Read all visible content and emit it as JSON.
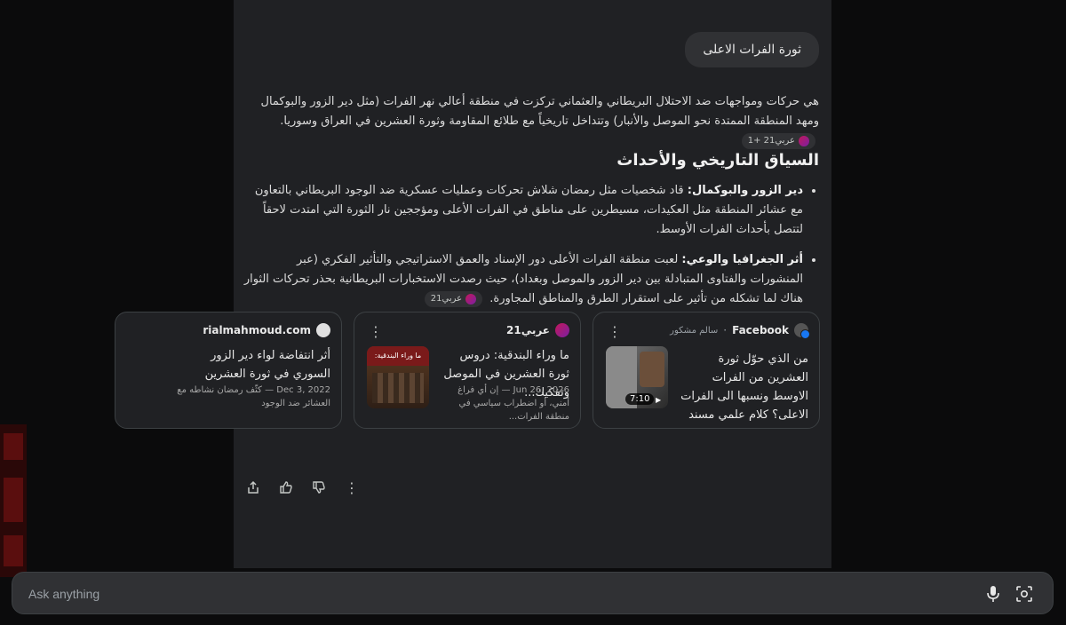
{
  "query": "ثورة الفرات الاعلى",
  "intro": {
    "text": "هي حركات ومواجهات ضد الاحتلال البريطاني والعثماني تركزت في منطقة أعالي نهر الفرات (مثل دير الزور والبوكمال ومهد المنطقة الممتدة نحو الموصل والأنبار) وتتداخل تاريخياً مع طلائع المقاومة وثورة العشرين في العراق وسوريا.",
    "citation": "عربي21 +1"
  },
  "section": {
    "heading": "السياق التاريخي والأحداث",
    "bullets": [
      {
        "bold": "دير الزور والبوكمال:",
        "text": " قاد شخصيات مثل رمضان شلاش تحركات وعمليات عسكرية ضد الوجود البريطاني بالتعاون مع عشائر المنطقة مثل العكيدات، مسيطرين على مناطق في الفرات الأعلى ومؤججين نار الثورة التي امتدت لاحقاً لتتصل بأحداث الفرات الأوسط.",
        "citation": ""
      },
      {
        "bold": "أثر الجغرافيا والوعي:",
        "text": " لعبت منطقة الفرات الأعلى دور الإسناد والعمق الاستراتيجي والتأثير الفكري (عبر المنشورات والفتاوى المتبادلة بين دير الزور والموصل وبغداد)، حيث رصدت الاستخبارات البريطانية بحذر تحركات الثوار هناك لما تشكله من تأثير على استقرار الطرق والمناطق المجاورة.",
        "citation": "عربي21"
      }
    ]
  },
  "cards": [
    {
      "source": "Facebook",
      "author": "سالم مشكور",
      "title": "من الذي حوّل ثورة العشرين من الفرات الاوسط ونسبها الى الفرات الاعلى؟ كلام علمي مسند بالادلة للدكتور عباس...",
      "meta": "",
      "duration": "7:10"
    },
    {
      "source": "عربي21",
      "author": "",
      "title": "ما وراء البندقية: دروس ثورة العشرين في الموصل وتفكيك...",
      "meta": "Jun 26, 2026 — إن أي فراغ أمني، أو اضطراب سياسي في منطقة الفرات...",
      "thumb_text": "ما وراء البندقية:"
    },
    {
      "source": "rialmahmoud.com",
      "author": "",
      "title": "أثر انتفاضة لواء دير الزور السوري في ثورة العشرين",
      "meta": "Dec 3, 2022 — كثّف رمضان نشاطه مع العشائر ضد الوجود"
    }
  ],
  "actions": [
    "share-icon",
    "thumb-up-icon",
    "thumb-down-icon",
    "more-vert-icon"
  ],
  "input": {
    "placeholder": "Ask anything"
  },
  "colors": {
    "background": "#0b0b0c",
    "panel": "#202124",
    "input": "#303134",
    "facebook": "#1877f2"
  }
}
